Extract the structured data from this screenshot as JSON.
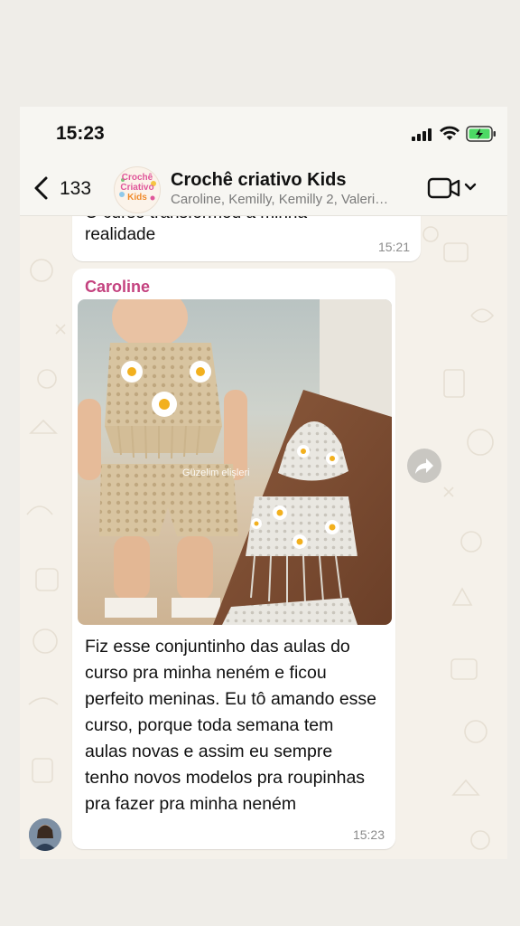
{
  "status_bar": {
    "time": "15:23"
  },
  "header": {
    "back_count": "133",
    "avatar_text": {
      "line1": "Crochê",
      "line2": "Criativo",
      "line3": "Kids"
    },
    "title": "Crochê criativo Kids",
    "subtitle": "Caroline, Kemilly, Kemilly 2, Valeri…"
  },
  "messages": [
    {
      "text_partial": "O curso transformou a minha",
      "text_line2": "realidade",
      "time": "15:21"
    },
    {
      "sender": "Caroline",
      "image_watermark": "Güzelim elişleri",
      "text": "Fiz esse conjuntinho das aulas do curso pra minha neném e ficou perfeito meninas. Eu tô amando esse curso, porque toda semana tem aulas novas e assim eu sempre tenho novos modelos pra roupinhas pra fazer pra minha neném",
      "time": "15:23"
    }
  ],
  "colors": {
    "sender": "#c4427f",
    "chat_bg": "#f5f1ea",
    "bubble": "#ffffff",
    "battery": "#4cd964"
  },
  "icons": [
    "back-chevron-icon",
    "signal-icon",
    "wifi-icon",
    "battery-charging-icon",
    "video-camera-icon",
    "chevron-down-icon",
    "forward-icon"
  ]
}
